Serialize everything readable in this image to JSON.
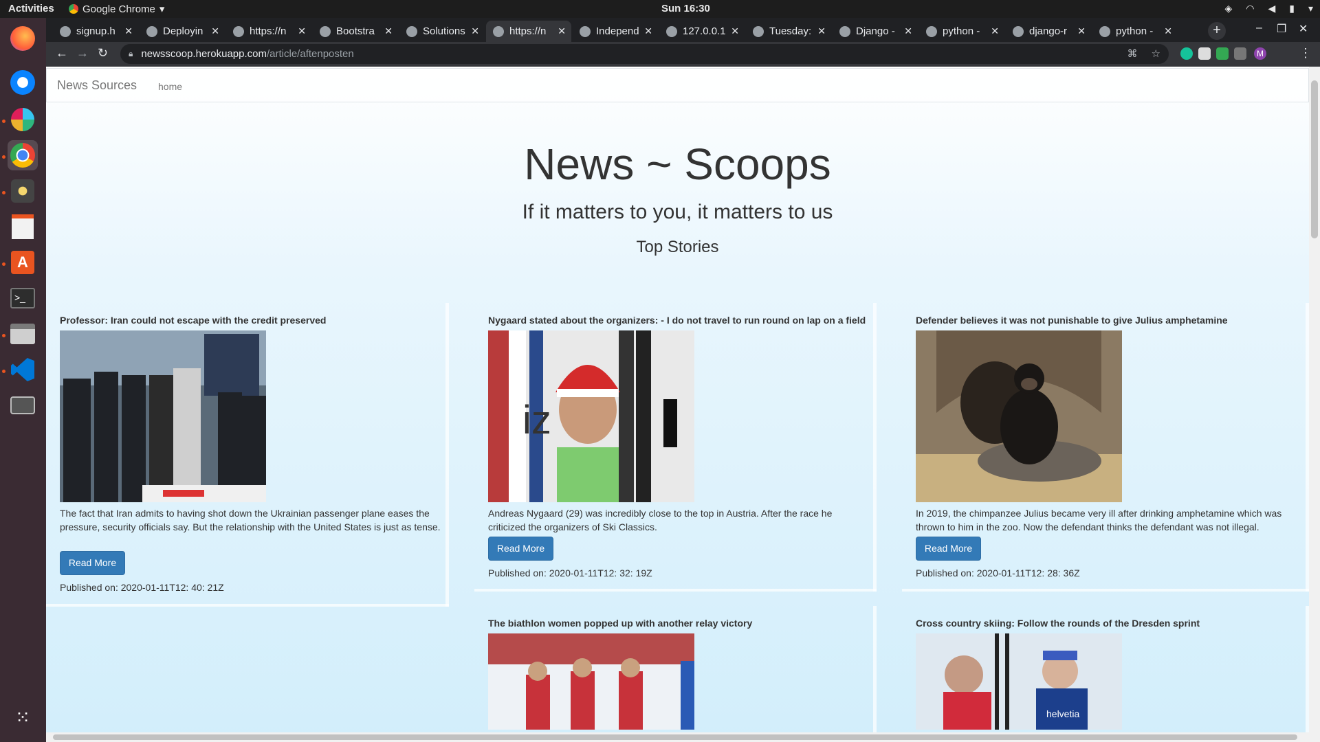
{
  "system": {
    "activities": "Activities",
    "app_name": "Google Chrome",
    "clock": "Sun 16:30"
  },
  "dock": {
    "apps": [
      "firefox-icon",
      "thunderbird-icon",
      "slack-icon",
      "chrome-icon",
      "rhythmbox-icon",
      "text-editor-icon",
      "software-center-icon",
      "terminal-icon",
      "files-icon",
      "vscode-icon",
      "screenshot-icon",
      "app-grid-icon"
    ]
  },
  "browser": {
    "tabs": [
      {
        "title": "signup.h",
        "active": false
      },
      {
        "title": "Deployin",
        "active": false
      },
      {
        "title": "https://n",
        "active": false
      },
      {
        "title": "Bootstra",
        "active": false
      },
      {
        "title": "Solutions",
        "active": false
      },
      {
        "title": "https://n",
        "active": true
      },
      {
        "title": "Independ",
        "active": false
      },
      {
        "title": "127.0.0.1",
        "active": false
      },
      {
        "title": "Tuesday:",
        "active": false
      },
      {
        "title": "Django -",
        "active": false
      },
      {
        "title": "python -",
        "active": false
      },
      {
        "title": "django-r",
        "active": false
      },
      {
        "title": "python -",
        "active": false
      }
    ],
    "url_host": "newsscoop.herokuapp.com",
    "url_path": "/article/aftenposten"
  },
  "page": {
    "brand": "News Sources",
    "nav_home": "home",
    "hero_title": "News ~ Scoops",
    "tagline": "If it matters to you, it matters to us",
    "section_title": "Top Stories",
    "read_more_label": "Read More",
    "articles": [
      {
        "title": "Professor: Iran could not escape with the credit preserved",
        "description": "The fact that Iran admits to having shot down the Ukrainian passenger plane eases the pressure, security officials say. But the relationship with the United States is just as tense.",
        "published": "Published on: 2020-01-11T12: 40: 21Z",
        "image": "iran-leaders-photo"
      },
      {
        "title": "Nygaard stated about the organizers: - I do not travel to run round on lap on a field",
        "description": "Andreas Nygaard (29) was incredibly close to the top in Austria. After the race he criticized the organizers of Ski Classics.",
        "published": "Published on: 2020-01-11T12: 32: 19Z",
        "image": "skier-portrait-photo"
      },
      {
        "title": "Defender believes it was not punishable to give Julius amphetamine",
        "description": "In 2019, the chimpanzee Julius became very ill after drinking amphetamine which was thrown to him in the zoo. Now the defendant thinks the defendant was not illegal.",
        "published": "Published on: 2020-01-11T12: 28: 36Z",
        "image": "chimpanzee-photo"
      },
      {
        "title": "The biathlon women popped up with another relay victory",
        "image": "biathlon-team-photo"
      },
      {
        "title": "Cross country skiing: Follow the rounds of the Dresden sprint",
        "image": "sprint-skiers-photo"
      }
    ]
  },
  "colors": {
    "button": "#337ab7",
    "gradient_top": "#ffffff",
    "gradient_bottom": "#d2eefb"
  }
}
